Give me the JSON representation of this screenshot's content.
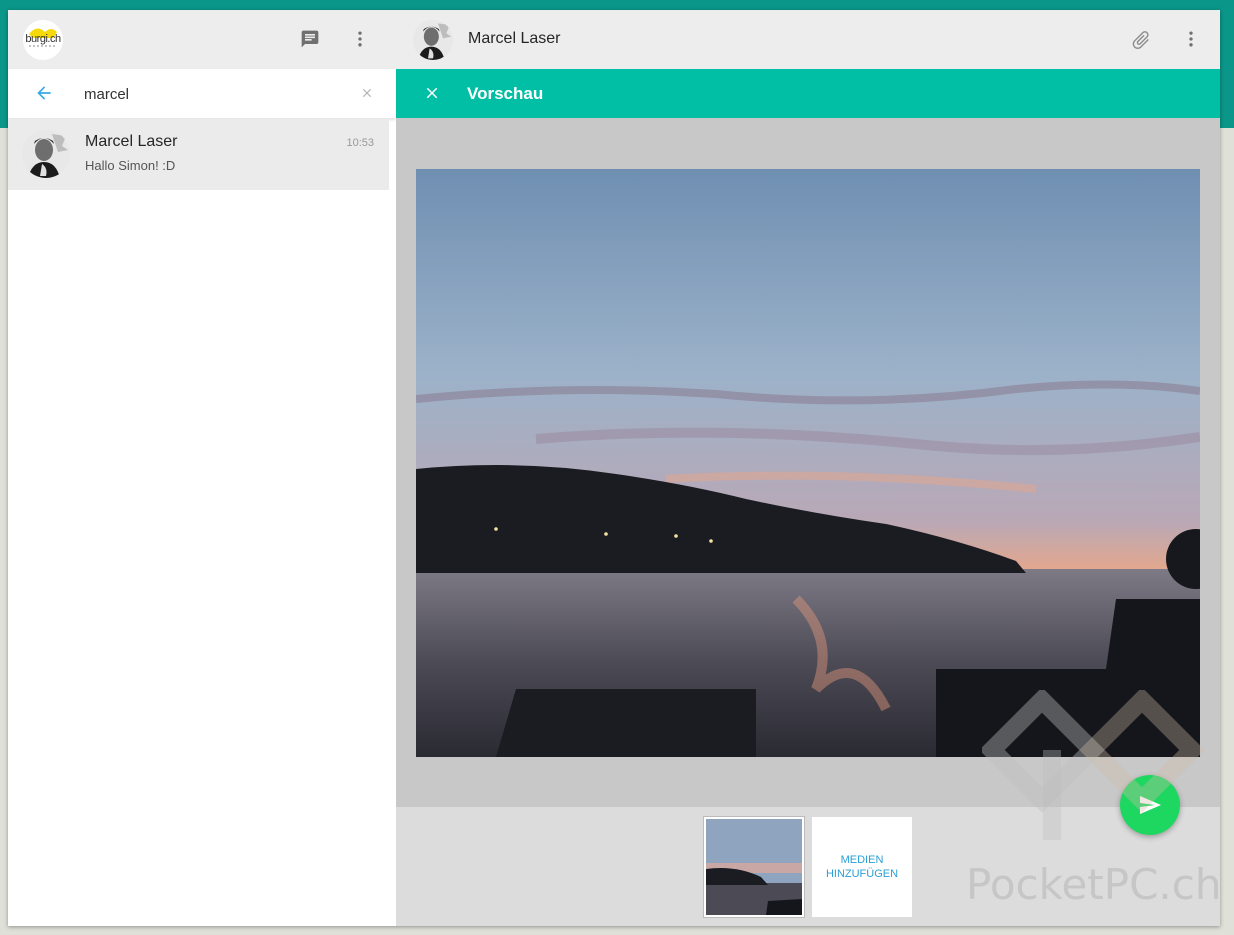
{
  "colors": {
    "teal_band": "#0a9688",
    "preview_bar": "#00bfa5",
    "send_button": "#1ed760",
    "search_back_arrow": "#38a9e0",
    "add_media_text": "#2a9fd6"
  },
  "sidebar": {
    "logo_text": "burgi.ch",
    "header_icons": [
      "new-chat-icon",
      "more-vert-icon"
    ],
    "search": {
      "value": "marcel",
      "back_icon": "arrow-back-icon",
      "clear_icon": "close-icon"
    },
    "results": [
      {
        "name": "Marcel Laser",
        "preview": "Hallo Simon! :D",
        "time": "10:53"
      }
    ]
  },
  "conversation": {
    "contact_name": "Marcel Laser",
    "header_icons": [
      "attach-icon",
      "more-vert-icon"
    ],
    "preview": {
      "title": "Vorschau",
      "close_icon": "close-icon",
      "add_media_label_line1": "MEDIEN",
      "add_media_label_line2": "HINZUFÜGEN",
      "send_icon": "send-icon"
    }
  },
  "watermark": "PocketPC.ch"
}
